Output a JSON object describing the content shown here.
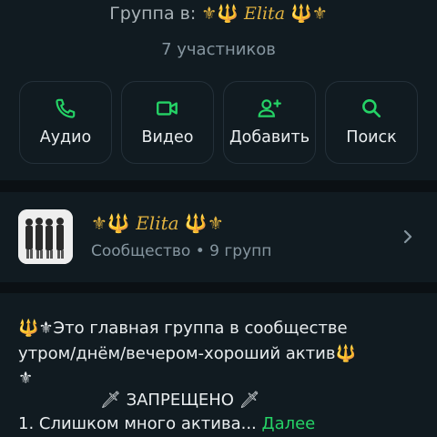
{
  "header": {
    "group_prefix": "Группа в:",
    "group_emblem_left": "⚜🔱",
    "group_name": "Elita",
    "group_emblem_right": "🔱⚜",
    "members": "7 участников"
  },
  "actions": [
    {
      "label": "Аудио",
      "icon": "phone-icon"
    },
    {
      "label": "Видео",
      "icon": "video-icon"
    },
    {
      "label": "Добавить",
      "icon": "add-person-icon"
    },
    {
      "label": "Поиск",
      "icon": "search-icon"
    }
  ],
  "community": {
    "emblem_left": "⚜🔱",
    "name": "Elita",
    "emblem_right": "🔱⚜",
    "subtitle": "Сообщество • 9 групп",
    "chevron": "chevron-right-icon"
  },
  "description": {
    "line1": "🔱⚜Это главная группа в сообществе",
    "line2": "утром/днём/вечером-хороший актив🔱",
    "line3": "⚜",
    "line4": "🗡 ЗАПРЕЩЕНО 🗡",
    "line5": "1. Слишком много актива...",
    "more": "Далее"
  },
  "colors": {
    "accent": "#25d366",
    "background": "#0b1014",
    "panel": "#111b21",
    "gold": "#e2b340"
  }
}
